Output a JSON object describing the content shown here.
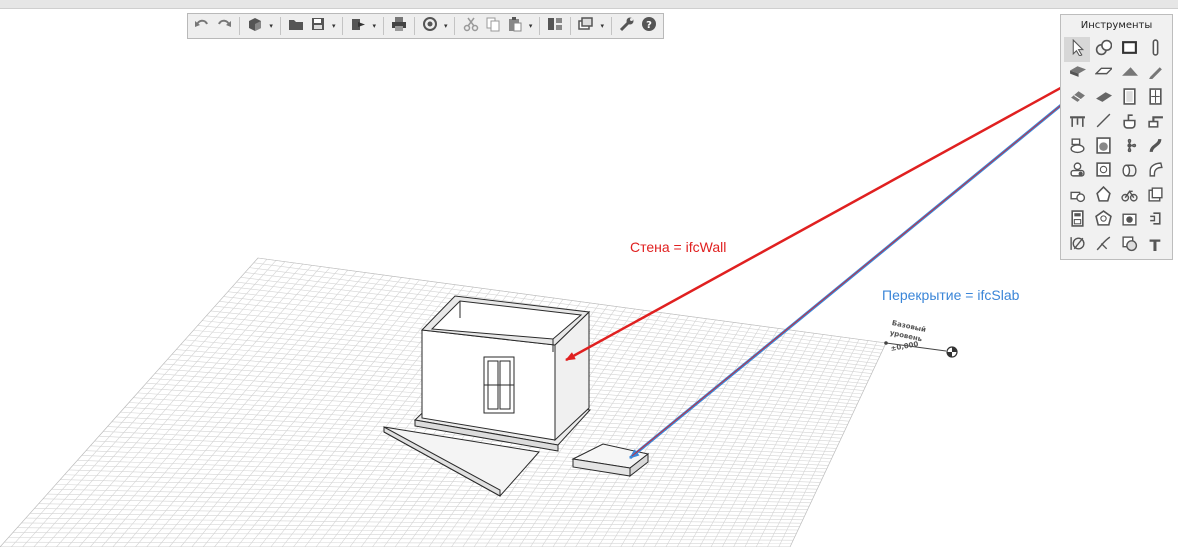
{
  "toolbar": {
    "buttons": [
      {
        "icon": "undo-icon"
      },
      {
        "icon": "redo-icon"
      },
      {
        "icon": "3d-view-icon",
        "dropdown": true
      },
      {
        "icon": "open-folder-icon"
      },
      {
        "icon": "save-icon",
        "dropdown": true
      },
      {
        "icon": "export-icon",
        "dropdown": true
      },
      {
        "icon": "print-icon"
      },
      {
        "icon": "view-rotate-icon",
        "dropdown": true
      },
      {
        "icon": "cut-icon"
      },
      {
        "icon": "copy-icon"
      },
      {
        "icon": "paste-icon",
        "dropdown": true
      },
      {
        "icon": "layers-panel-icon"
      },
      {
        "icon": "display-mode-icon",
        "dropdown": true
      },
      {
        "icon": "wrench-icon"
      },
      {
        "icon": "help-icon"
      }
    ]
  },
  "tools_panel": {
    "title": "Инструменты",
    "text_tool_label": "T",
    "tools": [
      "select-arrow-icon",
      "group-select-icon",
      "wall-tool-icon",
      "column-tool-icon",
      "slab-tool-icon",
      "beam-tool-icon",
      "roof-tool-icon",
      "pencil-tool-icon",
      "stair-tool-icon",
      "ramp-tool-icon",
      "door-tool-icon",
      "window-tool-icon",
      "table-tool-icon",
      "line-tool-icon",
      "washbasin-tool-icon",
      "faucet-tool-icon",
      "toilet-tool-icon",
      "washer-tool-icon",
      "fan-tool-icon",
      "pipe-tool-icon",
      "fixture-tool-icon",
      "panel-tool-icon",
      "duct-tool-icon",
      "elbow-tool-icon",
      "equipment-tool-icon",
      "light-tool-icon",
      "bike-tool-icon",
      "box-tool-icon",
      "cabinet-tool-icon",
      "shape-tool-icon",
      "camera-tool-icon",
      "bracket-tool-icon",
      "dimension-tool-icon",
      "curve-tool-icon",
      "hatch-tool-icon",
      "text-tool-icon"
    ]
  },
  "annotations": {
    "wall": "Стена = ifcWall",
    "slab": "Перекрытие = ifcSlab"
  },
  "level": {
    "name": "Базовый уровень",
    "elevation": "±0,000"
  },
  "colors": {
    "wall_arrow": "#e02020",
    "slab_arrow": "#3b86d8",
    "grid": "#d4d4d4"
  }
}
